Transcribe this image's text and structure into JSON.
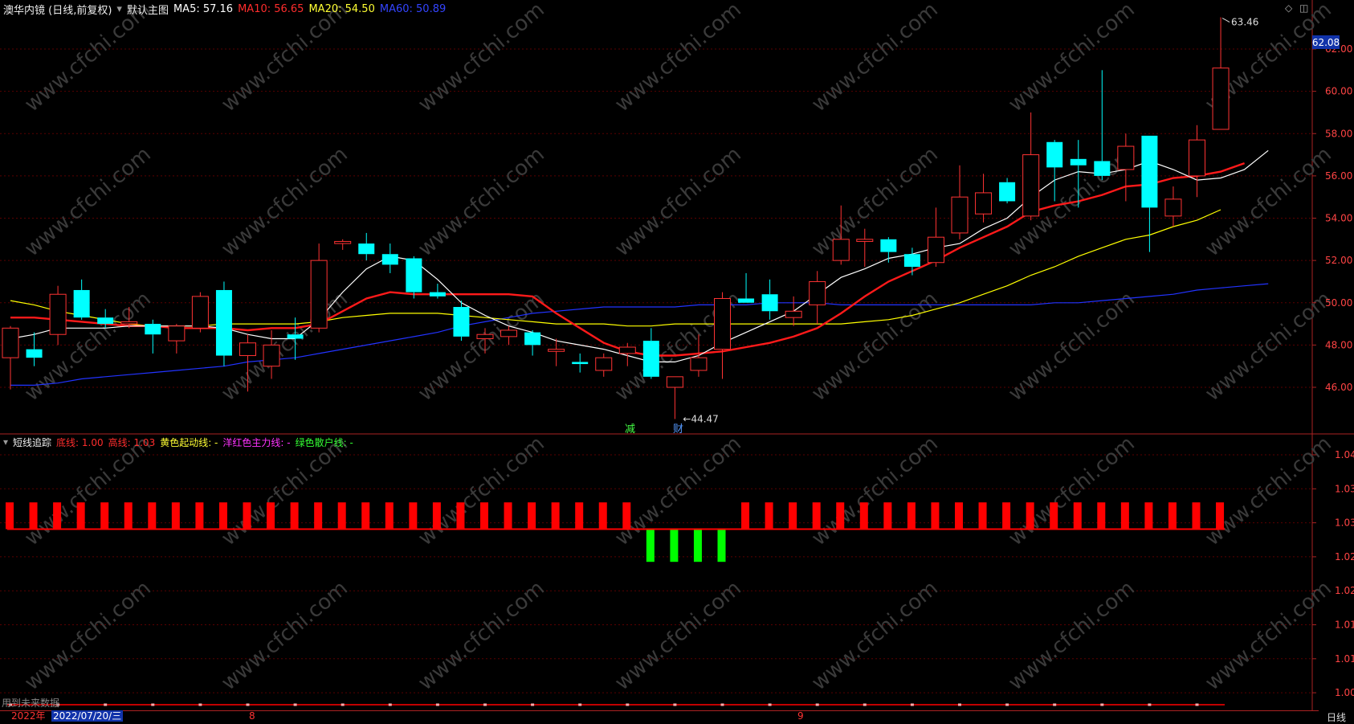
{
  "main_legend": {
    "title": "澳华内镜 (日线,前复权)",
    "panel_name": "默认主图",
    "ma5": "MA5: 57.16",
    "ma10": "MA10: 56.65",
    "ma20": "MA20: 54.50",
    "ma60": "MA60: 50.89"
  },
  "sub_legend": {
    "title": "短线追踪",
    "low_line": "底线: 1.00",
    "high_line": "高线: 1.03",
    "yellow_line": "黄色起动线: -",
    "magenta_line": "洋红色主力线: -",
    "green_line": "绿色散户线: -"
  },
  "watermark": "www.cfchi.com",
  "last_price_badge": "62.08",
  "high_annotation": "63.46",
  "low_annotation": "44.47",
  "event_markers": [
    "减",
    "财"
  ],
  "future_data_note": "用到未来数据",
  "date_bar": {
    "year": "2022年",
    "cursor_date": "2022/07/20/三",
    "month_8": "8",
    "month_9": "9"
  },
  "period_label": "日线",
  "colors": {
    "up": "#ff3333",
    "down": "#00ffff",
    "ma5": "#ffffff",
    "ma10": "#ff1a1a",
    "ma20": "#ffff00",
    "ma60": "#2233ff",
    "sub_up": "#ff0000",
    "sub_down": "#00ff00",
    "grid": "#5a0000",
    "axis": "#aa2222"
  },
  "chart_data": [
    {
      "type": "candlestick",
      "title": "",
      "ylim": [
        44,
        63.6
      ],
      "y_ticks": [
        "62.00",
        "60.00",
        "58.00",
        "56.00",
        "54.00",
        "52.00",
        "50.00",
        "48.00",
        "46.00"
      ],
      "candles": [
        {
          "o": 47.4,
          "h": 48.9,
          "l": 45.9,
          "c": 48.8
        },
        {
          "o": 47.8,
          "h": 48.6,
          "l": 47.0,
          "c": 47.4
        },
        {
          "o": 48.5,
          "h": 50.8,
          "l": 48.0,
          "c": 50.4
        },
        {
          "o": 50.6,
          "h": 51.1,
          "l": 49.2,
          "c": 49.3
        },
        {
          "o": 49.3,
          "h": 49.7,
          "l": 48.8,
          "c": 49.0
        },
        {
          "o": 49.0,
          "h": 49.8,
          "l": 48.8,
          "c": 49.1
        },
        {
          "o": 49.0,
          "h": 49.2,
          "l": 47.6,
          "c": 48.5
        },
        {
          "o": 48.2,
          "h": 49.0,
          "l": 47.6,
          "c": 48.9
        },
        {
          "o": 48.8,
          "h": 50.5,
          "l": 48.6,
          "c": 50.3
        },
        {
          "o": 50.6,
          "h": 51.0,
          "l": 47.0,
          "c": 47.5
        },
        {
          "o": 47.5,
          "h": 48.5,
          "l": 45.8,
          "c": 48.1
        },
        {
          "o": 47.0,
          "h": 48.7,
          "l": 46.4,
          "c": 48.0
        },
        {
          "o": 48.5,
          "h": 49.3,
          "l": 47.3,
          "c": 48.3
        },
        {
          "o": 48.8,
          "h": 52.8,
          "l": 48.6,
          "c": 52.0
        },
        {
          "o": 52.8,
          "h": 53.0,
          "l": 52.5,
          "c": 52.9
        },
        {
          "o": 52.8,
          "h": 53.3,
          "l": 52.0,
          "c": 52.3
        },
        {
          "o": 52.3,
          "h": 52.8,
          "l": 51.4,
          "c": 51.8
        },
        {
          "o": 52.1,
          "h": 52.2,
          "l": 50.2,
          "c": 50.5
        },
        {
          "o": 50.5,
          "h": 50.9,
          "l": 50.2,
          "c": 50.3
        },
        {
          "o": 49.8,
          "h": 50.1,
          "l": 48.2,
          "c": 48.4
        },
        {
          "o": 48.3,
          "h": 48.8,
          "l": 47.6,
          "c": 48.5
        },
        {
          "o": 48.4,
          "h": 48.9,
          "l": 48.0,
          "c": 48.7
        },
        {
          "o": 48.6,
          "h": 48.7,
          "l": 47.5,
          "c": 48.0
        },
        {
          "o": 47.7,
          "h": 48.3,
          "l": 47.0,
          "c": 47.8
        },
        {
          "o": 47.2,
          "h": 47.6,
          "l": 46.7,
          "c": 47.1
        },
        {
          "o": 46.8,
          "h": 47.6,
          "l": 46.5,
          "c": 47.4
        },
        {
          "o": 47.6,
          "h": 48.1,
          "l": 47.0,
          "c": 47.9
        },
        {
          "o": 48.2,
          "h": 48.8,
          "l": 46.4,
          "c": 46.5
        },
        {
          "o": 46.0,
          "h": 46.5,
          "l": 44.5,
          "c": 46.5
        },
        {
          "o": 46.8,
          "h": 48.5,
          "l": 46.5,
          "c": 47.4
        },
        {
          "o": 47.8,
          "h": 50.5,
          "l": 46.4,
          "c": 50.2
        },
        {
          "o": 50.2,
          "h": 51.4,
          "l": 50.0,
          "c": 50.0
        },
        {
          "o": 50.4,
          "h": 51.1,
          "l": 49.2,
          "c": 49.6
        },
        {
          "o": 49.3,
          "h": 50.3,
          "l": 48.9,
          "c": 49.6
        },
        {
          "o": 49.9,
          "h": 51.5,
          "l": 49.0,
          "c": 51.0
        },
        {
          "o": 52.0,
          "h": 54.6,
          "l": 51.8,
          "c": 53.0
        },
        {
          "o": 52.9,
          "h": 53.5,
          "l": 51.7,
          "c": 53.0
        },
        {
          "o": 53.0,
          "h": 53.1,
          "l": 51.9,
          "c": 52.4
        },
        {
          "o": 52.3,
          "h": 52.6,
          "l": 51.3,
          "c": 51.7
        },
        {
          "o": 51.9,
          "h": 54.5,
          "l": 51.7,
          "c": 53.1
        },
        {
          "o": 53.3,
          "h": 56.5,
          "l": 53.0,
          "c": 55.0
        },
        {
          "o": 54.2,
          "h": 56.1,
          "l": 53.8,
          "c": 55.2
        },
        {
          "o": 55.7,
          "h": 55.9,
          "l": 54.7,
          "c": 54.8
        },
        {
          "o": 54.1,
          "h": 59.0,
          "l": 53.9,
          "c": 57.0
        },
        {
          "o": 57.6,
          "h": 57.7,
          "l": 54.8,
          "c": 56.4
        },
        {
          "o": 56.8,
          "h": 57.7,
          "l": 54.5,
          "c": 56.5
        },
        {
          "o": 56.7,
          "h": 61.0,
          "l": 55.8,
          "c": 56.0
        },
        {
          "o": 56.3,
          "h": 58.0,
          "l": 54.8,
          "c": 57.4
        },
        {
          "o": 57.9,
          "h": 57.9,
          "l": 52.4,
          "c": 54.5
        },
        {
          "o": 54.1,
          "h": 55.5,
          "l": 53.6,
          "c": 54.9
        },
        {
          "o": 56.0,
          "h": 58.4,
          "l": 55.0,
          "c": 57.7
        },
        {
          "o": 58.2,
          "h": 63.5,
          "l": 58.2,
          "c": 61.1
        }
      ],
      "ma5": [
        48.3,
        48.5,
        48.8,
        48.8,
        48.8,
        48.9,
        48.9,
        48.9,
        48.9,
        48.8,
        48.5,
        48.3,
        48.3,
        49.2,
        50.5,
        51.6,
        52.2,
        52.0,
        51.1,
        50.0,
        49.4,
        48.9,
        48.6,
        48.2,
        48.0,
        47.8,
        47.5,
        47.2,
        47.2,
        47.5,
        48.1,
        48.6,
        49.1,
        49.6,
        50.4,
        51.2,
        51.6,
        52.1,
        52.3,
        52.6,
        52.8,
        53.5,
        54.0,
        55.0,
        55.8,
        56.2,
        56.1,
        56.3,
        56.7,
        56.3,
        55.8,
        55.9,
        56.3,
        57.2
      ],
      "ma10": [
        49.3,
        49.3,
        49.2,
        49.1,
        49.0,
        48.9,
        48.9,
        48.8,
        48.8,
        48.8,
        48.7,
        48.8,
        48.8,
        49.0,
        49.6,
        50.2,
        50.5,
        50.4,
        50.4,
        50.4,
        50.4,
        50.4,
        50.3,
        49.5,
        48.8,
        48.1,
        47.7,
        47.5,
        47.5,
        47.6,
        47.7,
        47.9,
        48.1,
        48.4,
        48.8,
        49.5,
        50.3,
        51.0,
        51.5,
        52.0,
        52.6,
        53.1,
        53.6,
        54.3,
        54.6,
        54.8,
        55.1,
        55.5,
        55.6,
        55.9,
        56.0,
        56.2,
        56.6
      ],
      "ma20": [
        50.1,
        49.9,
        49.6,
        49.4,
        49.2,
        49.0,
        48.9,
        48.9,
        48.9,
        49.0,
        49.0,
        49.0,
        49.0,
        49.1,
        49.3,
        49.4,
        49.5,
        49.5,
        49.5,
        49.4,
        49.3,
        49.2,
        49.1,
        49.0,
        49.0,
        49.0,
        48.9,
        48.9,
        49.0,
        49.0,
        49.0,
        49.0,
        49.0,
        49.0,
        49.0,
        49.0,
        49.1,
        49.2,
        49.4,
        49.7,
        50.0,
        50.4,
        50.8,
        51.3,
        51.7,
        52.2,
        52.6,
        53.0,
        53.2,
        53.6,
        53.9,
        54.4
      ],
      "ma60": [
        46.1,
        46.1,
        46.2,
        46.4,
        46.5,
        46.6,
        46.7,
        46.8,
        46.9,
        47.0,
        47.2,
        47.3,
        47.4,
        47.6,
        47.8,
        48.0,
        48.2,
        48.4,
        48.6,
        48.9,
        49.1,
        49.3,
        49.5,
        49.6,
        49.7,
        49.8,
        49.8,
        49.8,
        49.8,
        49.9,
        49.9,
        49.9,
        50.0,
        50.0,
        50.0,
        49.9,
        49.9,
        49.9,
        49.9,
        49.9,
        49.9,
        49.9,
        49.9,
        49.9,
        50.0,
        50.0,
        50.1,
        50.2,
        50.3,
        50.4,
        50.6,
        50.7,
        50.8,
        50.9
      ],
      "ylabel": ""
    },
    {
      "type": "bar",
      "title": "",
      "ylim": [
        0.995,
        1.042
      ],
      "y_ticks": [
        "1.04",
        "1.03",
        "1.03",
        "1.02",
        "1.02",
        "1.01",
        "1.01",
        "1.00"
      ],
      "baseline": 1.0275,
      "values": [
        1.032,
        1.032,
        1.032,
        1.032,
        1.032,
        1.032,
        1.032,
        1.032,
        1.032,
        1.032,
        1.032,
        1.032,
        1.032,
        1.032,
        1.032,
        1.032,
        1.032,
        1.032,
        1.032,
        1.032,
        1.032,
        1.032,
        1.032,
        1.032,
        1.032,
        1.032,
        1.032,
        1.022,
        1.022,
        1.022,
        1.022,
        1.032,
        1.032,
        1.032,
        1.032,
        1.032,
        1.032,
        1.032,
        1.032,
        1.032,
        1.032,
        1.032,
        1.032,
        1.032,
        1.032,
        1.032,
        1.032,
        1.032,
        1.032,
        1.032,
        1.032,
        1.032
      ],
      "low_line": 1.0,
      "ylabel": ""
    }
  ]
}
